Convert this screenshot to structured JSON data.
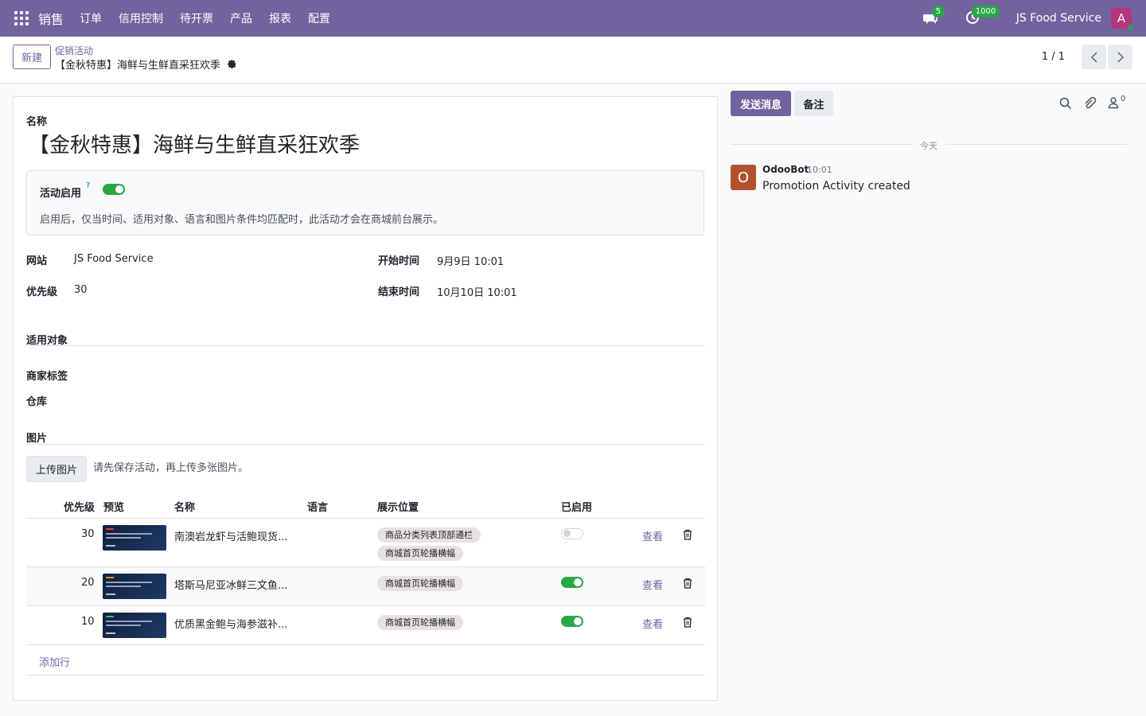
{
  "nav": {
    "app_name": "销售",
    "menu": [
      "订单",
      "信用控制",
      "待开票",
      "产品",
      "报表",
      "配置"
    ],
    "messages_count": "5",
    "activities_count": "1000",
    "company": "JS Food Service",
    "avatar_letter": "A"
  },
  "control_panel": {
    "new_button": "新建",
    "breadcrumb_parent": "促销活动",
    "breadcrumb_current": "【金秋特惠】海鲜与生鲜直采狂欢季",
    "pager": "1 / 1"
  },
  "form": {
    "name_label": "名称",
    "name_value": "【金秋特惠】海鲜与生鲜直采狂欢季",
    "active_label": "活动启用",
    "active_help": "?",
    "active_on": true,
    "active_hint": "启用后，仅当时间、适用对象、语言和图片条件均匹配时，此活动才会在商城前台展示。",
    "website_label": "网站",
    "website_value": "JS Food Service",
    "priority_label": "优先级",
    "priority_value": "30",
    "start_label": "开始时间",
    "start_value": "9月9日 10:01",
    "end_label": "结束时间",
    "end_value": "10月10日 10:01",
    "audience_section": "适用对象",
    "merchant_tags_label": "商家标签",
    "warehouse_label": "仓库",
    "images_section": "图片",
    "upload_button": "上传图片",
    "upload_hint": "请先保存活动，再上传多张图片。"
  },
  "table": {
    "headers": {
      "priority": "优先级",
      "preview": "预览",
      "name": "名称",
      "language": "语言",
      "position": "展示位置",
      "enabled": "已启用"
    },
    "rows": [
      {
        "priority": "30",
        "name": "南澳岩龙虾与活鲍现货...",
        "language": "",
        "positions": [
          "商品分类列表顶部通栏",
          "商城首页轮播横幅"
        ],
        "enabled": false,
        "view": "查看"
      },
      {
        "priority": "20",
        "name": "塔斯马尼亚冰鲜三文鱼...",
        "language": "",
        "positions": [
          "商城首页轮播横幅"
        ],
        "enabled": true,
        "view": "查看"
      },
      {
        "priority": "10",
        "name": "优质黑金鲍与海参滋补...",
        "language": "",
        "positions": [
          "商城首页轮播横幅"
        ],
        "enabled": true,
        "view": "查看"
      }
    ],
    "add_line": "添加行"
  },
  "chatter": {
    "send_message": "发送消息",
    "log_note": "备注",
    "followers_count": "0",
    "today": "今天",
    "messages": [
      {
        "avatar": "O",
        "author": "OdooBot",
        "time": "10:01",
        "body": "Promotion Activity created"
      }
    ]
  },
  "colors": {
    "brand": "#71639e",
    "success": "#28a745",
    "tag_bg": "#e7e1e2"
  }
}
